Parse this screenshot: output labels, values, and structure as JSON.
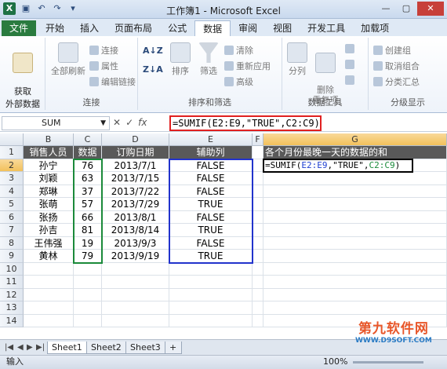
{
  "window": {
    "title": "工作簿1 - Microsoft Excel",
    "logo": "X"
  },
  "ribbon_tabs": [
    "文件",
    "开始",
    "插入",
    "页面布局",
    "公式",
    "数据",
    "审阅",
    "视图",
    "开发工具",
    "加载项"
  ],
  "ribbon": {
    "get_external": "获取\n外部数据",
    "refresh_all": "全部刷新",
    "connections": "连接",
    "properties": "属性",
    "edit_links": "编辑链接",
    "group_connections": "连接",
    "sort": "排序",
    "filter": "筛选",
    "clear": "清除",
    "reapply": "重新应用",
    "advanced": "高级",
    "group_sortfilter": "排序和筛选",
    "split": "分列",
    "remove_dup": "删除\n重复项",
    "group_datatools": "数据工具",
    "group": "创建组",
    "ungroup": "取消组合",
    "subtotal": "分类汇总",
    "group_outline": "分级显示"
  },
  "formula_bar": {
    "name_box": "SUM",
    "fx": "fx",
    "formula": "=SUMIF(E2:E9,\"TRUE\",C2:C9)"
  },
  "columns": [
    "B",
    "C",
    "D",
    "E",
    "F",
    "G"
  ],
  "rows": [
    "1",
    "2",
    "3",
    "4",
    "5",
    "6",
    "7",
    "8",
    "9",
    "10",
    "11",
    "12",
    "13",
    "14"
  ],
  "table": {
    "headers": [
      "销售人员",
      "数据",
      "订购日期",
      "辅助列"
    ],
    "rows": [
      [
        "孙宁",
        "76",
        "2013/7/1",
        "FALSE"
      ],
      [
        "刘颖",
        "63",
        "2013/7/15",
        "FALSE"
      ],
      [
        "郑琳",
        "37",
        "2013/7/22",
        "FALSE"
      ],
      [
        "张萌",
        "57",
        "2013/7/29",
        "TRUE"
      ],
      [
        "张扬",
        "66",
        "2013/8/1",
        "FALSE"
      ],
      [
        "孙吉",
        "81",
        "2013/8/14",
        "TRUE"
      ],
      [
        "王伟强",
        "19",
        "2013/9/3",
        "FALSE"
      ],
      [
        "黄林",
        "79",
        "2013/9/19",
        "TRUE"
      ]
    ]
  },
  "g_header": "各个月份最晚一天的数据的和",
  "g_formula": {
    "prefix": "=SUMIF(",
    "ref1": "E2:E9",
    "mid": ",\"TRUE\",",
    "ref2": "C2:C9",
    "suffix": ")"
  },
  "sheets": [
    "Sheet1",
    "Sheet2",
    "Sheet3"
  ],
  "status": {
    "mode": "输入",
    "zoom": "100%"
  },
  "watermark": {
    "line1": "第九软件网",
    "line2": "WWW.D9SOFT.COM"
  },
  "colors": {
    "file_tab": "#2a7b3f",
    "highlight": "#e02020",
    "range_blue": "#2233cc",
    "range_green": "#1b8a3a"
  }
}
